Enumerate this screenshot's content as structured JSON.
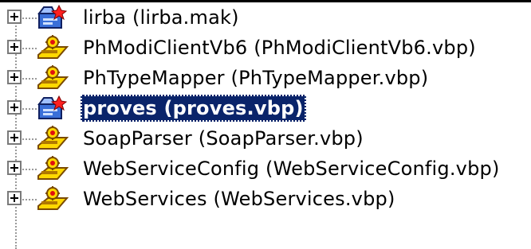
{
  "tree": {
    "items": [
      {
        "label": "lirba (lirba.mak)",
        "icon": "makefile-project-icon",
        "selected": false
      },
      {
        "label": "PhModiClientVb6 (PhModiClientVb6.vbp)",
        "icon": "vb-project-icon",
        "selected": false
      },
      {
        "label": "PhTypeMapper (PhTypeMapper.vbp)",
        "icon": "vb-project-icon",
        "selected": false
      },
      {
        "label": "proves (proves.vbp)",
        "icon": "vb-startup-project-icon",
        "selected": true
      },
      {
        "label": "SoapParser (SoapParser.vbp)",
        "icon": "vb-project-icon",
        "selected": false
      },
      {
        "label": "WebServiceConfig (WebServiceConfig.vbp)",
        "icon": "vb-project-icon",
        "selected": false
      },
      {
        "label": "WebServices (WebServices.vbp)",
        "icon": "vb-project-icon",
        "selected": false
      }
    ],
    "colors": {
      "selection_bg": "#0a246a",
      "selection_fg": "#ffffff",
      "icon_yellow": "#ffd800",
      "icon_red": "#e01010"
    }
  }
}
